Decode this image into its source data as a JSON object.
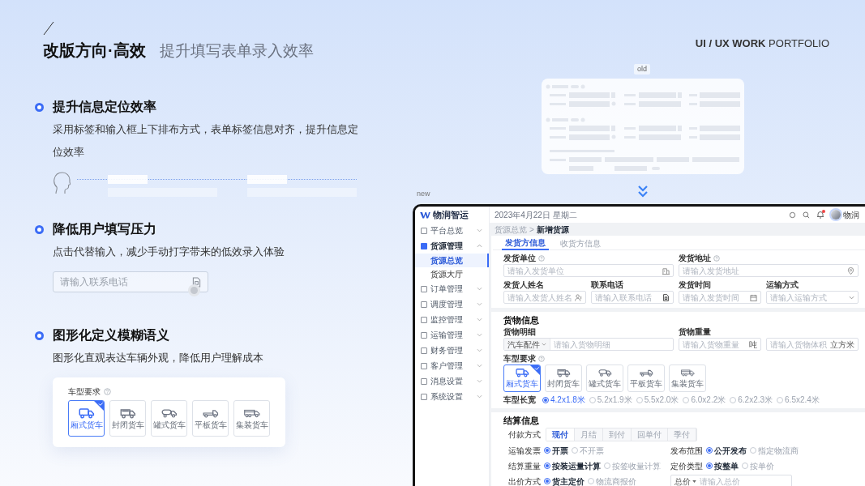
{
  "slide": {
    "title": "改版方向·高效",
    "subtitle": "提升填写表单录入效率",
    "portfolio": "**UI / UX WORK** PORTFOLIO"
  },
  "points": [
    {
      "heading": "提升信息定位效率",
      "text": "采用标签和输入框上下排布方式，表单标签信息对齐，提升信息定位效率",
      "demo": {
        "kind": "scan"
      }
    },
    {
      "heading": "降低用户填写压力",
      "text": "点击代替输入，减少手动打字带来的低效录入体验",
      "demo": {
        "kind": "field",
        "placeholder": "请输入联系电话"
      }
    },
    {
      "heading": "图形化定义模糊语义",
      "text": "图形化直观表达车辆外观，降低用户理解成本",
      "demo": {
        "kind": "vehicles",
        "label": "车型要求",
        "options": [
          {
            "label": "厢式货车",
            "selected": true
          },
          {
            "label": "封闭货车",
            "selected": false
          },
          {
            "label": "罐式货车",
            "selected": false
          },
          {
            "label": "平板货车",
            "selected": false
          },
          {
            "label": "集装货车",
            "selected": false
          }
        ]
      }
    }
  ],
  "old_design": {
    "tag": "old"
  },
  "new_design": {
    "tag": "new",
    "app": {
      "brand": "物润智运",
      "date": "2023年4月22日 星期二",
      "user": "物润",
      "notification_dot": true,
      "sidebar": [
        {
          "label": "平台总览",
          "expanded": false
        },
        {
          "label": "货源管理",
          "expanded": true,
          "children": [
            {
              "label": "货源总览",
              "selected": true
            },
            {
              "label": "货源大厅",
              "selected": false
            }
          ]
        },
        {
          "label": "订单管理",
          "expanded": false
        },
        {
          "label": "调度管理",
          "expanded": false
        },
        {
          "label": "监控管理",
          "expanded": false
        },
        {
          "label": "运输管理",
          "expanded": false
        },
        {
          "label": "财务管理",
          "expanded": false
        },
        {
          "label": "客户管理",
          "expanded": false
        },
        {
          "label": "消息设置",
          "expanded": false
        },
        {
          "label": "系统设置",
          "expanded": false
        }
      ],
      "breadcrumb": {
        "items": [
          "货源总览",
          "新增货源"
        ],
        "separator": ">"
      },
      "tabs": [
        {
          "label": "发货方信息",
          "selected": true
        },
        {
          "label": "收货方信息",
          "selected": false
        }
      ],
      "shipper_fields": [
        {
          "label": "发货单位",
          "help": true,
          "placeholder": "请输入发货单位",
          "kind": "company"
        },
        {
          "label": "发货地址",
          "help": true,
          "placeholder": "请输入发货地址",
          "kind": "address"
        },
        {
          "label": "发货人姓名",
          "help": false,
          "placeholder": "请输入发货人姓名",
          "kind": "person"
        },
        {
          "label": "联系电话",
          "help": false,
          "placeholder": "请输入联系电话",
          "kind": "phone"
        },
        {
          "label": "发货时间",
          "help": false,
          "placeholder": "请输入发货时间",
          "kind": "date"
        },
        {
          "label": "运输方式",
          "help": false,
          "placeholder": "请输入运输方式",
          "kind": "select"
        }
      ],
      "cargo": {
        "title": "货物信息",
        "detail": {
          "label": "货物明细",
          "category": "汽车配件",
          "placeholder": "请输入货物明细"
        },
        "weight": {
          "label": "货物重量",
          "placeholder": "请输入货物重量",
          "unit": "吨"
        },
        "volume": {
          "placeholder": "请输入货物体积",
          "unit": "立方米"
        },
        "vehicle_label": "车型要求",
        "vehicles": [
          {
            "label": "厢式货车",
            "selected": true
          },
          {
            "label": "封闭货车",
            "selected": false
          },
          {
            "label": "罐式货车",
            "selected": false
          },
          {
            "label": "平板货车",
            "selected": false
          },
          {
            "label": "集装货车",
            "selected": false
          }
        ],
        "size_label": "车型长宽",
        "sizes": [
          {
            "label": "4.2x1.8米",
            "selected": true
          },
          {
            "label": "5.2x1.9米",
            "selected": false
          },
          {
            "label": "5.5x2.0米",
            "selected": false
          },
          {
            "label": "6.0x2.2米",
            "selected": false
          },
          {
            "label": "6.2x2.3米",
            "selected": false
          },
          {
            "label": "6.5x2.4米",
            "selected": false
          }
        ]
      },
      "settlement": {
        "title": "结算信息",
        "payment_label": "付款方式",
        "payment_options": [
          {
            "label": "现付",
            "selected": true
          },
          {
            "label": "月结",
            "selected": false
          },
          {
            "label": "到付",
            "selected": false
          },
          {
            "label": "回单付",
            "selected": false
          },
          {
            "label": "季付",
            "selected": false
          }
        ],
        "groups": [
          {
            "label": "运输发票",
            "options": [
              {
                "label": "开票",
                "selected": true
              },
              {
                "label": "不开票",
                "selected": false
              }
            ]
          },
          {
            "label": "发布范围",
            "options": [
              {
                "label": "公开发布",
                "selected": true
              },
              {
                "label": "指定物流商",
                "selected": false
              }
            ]
          },
          {
            "label": "结算重量",
            "options": [
              {
                "label": "按装运量计算",
                "selected": true
              },
              {
                "label": "按签收量计算",
                "selected": false
              }
            ]
          },
          {
            "label": "定价类型",
            "options": [
              {
                "label": "按整单",
                "selected": true
              },
              {
                "label": "按单价",
                "selected": false
              }
            ]
          },
          {
            "label": "出价方式",
            "options": [
              {
                "label": "货主定价",
                "selected": true
              },
              {
                "label": "物流商报价",
                "selected": false
              }
            ]
          }
        ],
        "price": {
          "prefix": "总价",
          "placeholder": "请输入总价"
        }
      }
    }
  }
}
